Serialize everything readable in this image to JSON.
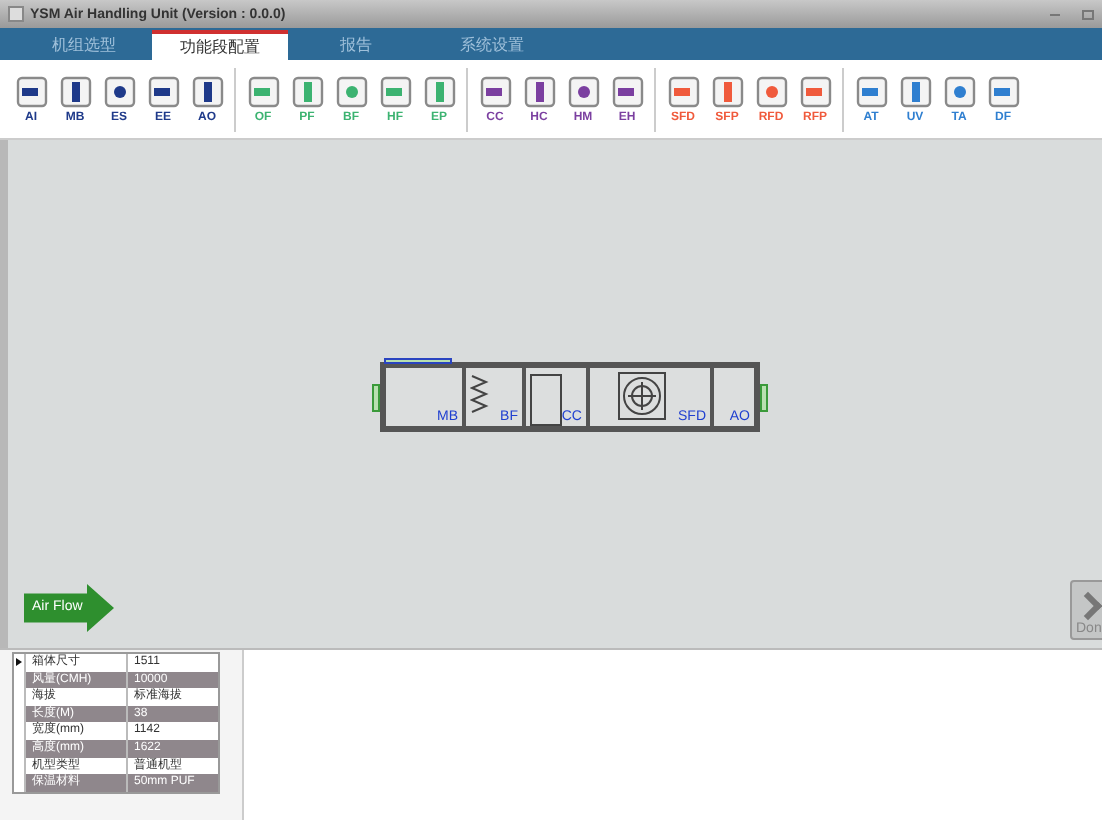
{
  "window": {
    "title": "YSM Air Handling Unit (Version : 0.0.0)"
  },
  "tabs": [
    {
      "label": "机组选型",
      "selected": false
    },
    {
      "label": "功能段配置",
      "selected": true
    },
    {
      "label": "报告",
      "selected": false
    },
    {
      "label": "系统设置",
      "selected": false
    }
  ],
  "toolbar": [
    {
      "items": [
        {
          "label": "AI",
          "color": "#1f3a8a"
        },
        {
          "label": "MB",
          "color": "#1f3a8a"
        },
        {
          "label": "ES",
          "color": "#1f3a8a"
        },
        {
          "label": "EE",
          "color": "#1f3a8a"
        },
        {
          "label": "AO",
          "color": "#1f3a8a"
        }
      ]
    },
    {
      "items": [
        {
          "label": "OF",
          "color": "#3cb371"
        },
        {
          "label": "PF",
          "color": "#3cb371"
        },
        {
          "label": "BF",
          "color": "#3cb371"
        },
        {
          "label": "HF",
          "color": "#3cb371"
        },
        {
          "label": "EP",
          "color": "#3cb371"
        }
      ]
    },
    {
      "items": [
        {
          "label": "CC",
          "color": "#7b3fa0"
        },
        {
          "label": "HC",
          "color": "#7b3fa0"
        },
        {
          "label": "HM",
          "color": "#7b3fa0"
        },
        {
          "label": "EH",
          "color": "#7b3fa0"
        }
      ]
    },
    {
      "items": [
        {
          "label": "SFD",
          "color": "#f05a3c"
        },
        {
          "label": "SFP",
          "color": "#f05a3c"
        },
        {
          "label": "RFD",
          "color": "#f05a3c"
        },
        {
          "label": "RFP",
          "color": "#f05a3c"
        }
      ]
    },
    {
      "items": [
        {
          "label": "AT",
          "color": "#2f7fd0"
        },
        {
          "label": "UV",
          "color": "#2f7fd0"
        },
        {
          "label": "TA",
          "color": "#2f7fd0"
        },
        {
          "label": "DF",
          "color": "#2f7fd0"
        }
      ]
    }
  ],
  "unit": {
    "sections": [
      {
        "label": "MB",
        "kind": "damper"
      },
      {
        "label": "BF",
        "kind": "filter"
      },
      {
        "label": "CC",
        "kind": "coil"
      },
      {
        "label": "SFD",
        "kind": "fan"
      },
      {
        "label": "AO",
        "kind": "outlet"
      }
    ]
  },
  "air_flow_button": "Air Flow",
  "done_button": "Don",
  "properties": [
    {
      "name": "箱体尺寸",
      "value": "1511",
      "current": true
    },
    {
      "name": "风量(CMH)",
      "value": "10000",
      "current": false
    },
    {
      "name": "海拔",
      "value": "标准海拔",
      "current": false
    },
    {
      "name": "长度(M)",
      "value": "38",
      "current": false
    },
    {
      "name": "宽度(mm)",
      "value": "1142",
      "current": false
    },
    {
      "name": "高度(mm)",
      "value": "1622",
      "current": false
    },
    {
      "name": "机型类型",
      "value": "普通机型",
      "current": false
    },
    {
      "name": "保温材料",
      "value": "50mm PUF",
      "current": false
    }
  ]
}
